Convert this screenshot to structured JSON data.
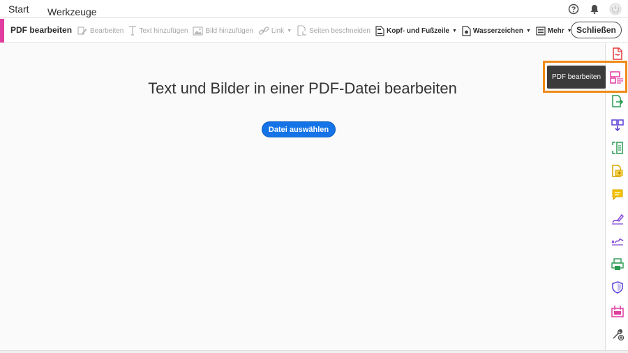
{
  "menu": {
    "start": "Start",
    "tools": "Werkzeuge"
  },
  "toolbar": {
    "title": "PDF bearbeiten",
    "tools": [
      {
        "label": "Bearbeiten",
        "enabled": false
      },
      {
        "label": "Text hinzufügen",
        "enabled": false
      },
      {
        "label": "Bild hinzufügen",
        "enabled": false
      },
      {
        "label": "Link",
        "enabled": false
      },
      {
        "label": "Seiten beschneiden",
        "enabled": false
      },
      {
        "label": "Kopf- und Fußzeile",
        "enabled": true
      },
      {
        "label": "Wasserzeichen",
        "enabled": true
      },
      {
        "label": "Mehr",
        "enabled": true
      }
    ],
    "close_label": "Schließen"
  },
  "main": {
    "headline": "Text und Bilder in einer PDF-Datei bearbeiten",
    "select_file_label": "Datei auswählen"
  },
  "tooltip": {
    "label": "PDF bearbeiten"
  },
  "colors": {
    "accent_pink": "#e03ca1",
    "primary_blue": "#1473e6",
    "highlight_orange": "#ef8a19",
    "tooltip_bg": "#3b3b3b"
  },
  "sidebar_icons": [
    "create-pdf-icon",
    "edit-pdf-icon",
    "export-pdf-icon",
    "organize-pages-icon",
    "scan-ocr-icon",
    "combine-files-icon",
    "comment-icon",
    "fill-sign-icon",
    "request-signature-icon",
    "print-production-icon",
    "protect-icon",
    "prepare-form-icon",
    "more-tools-icon"
  ]
}
